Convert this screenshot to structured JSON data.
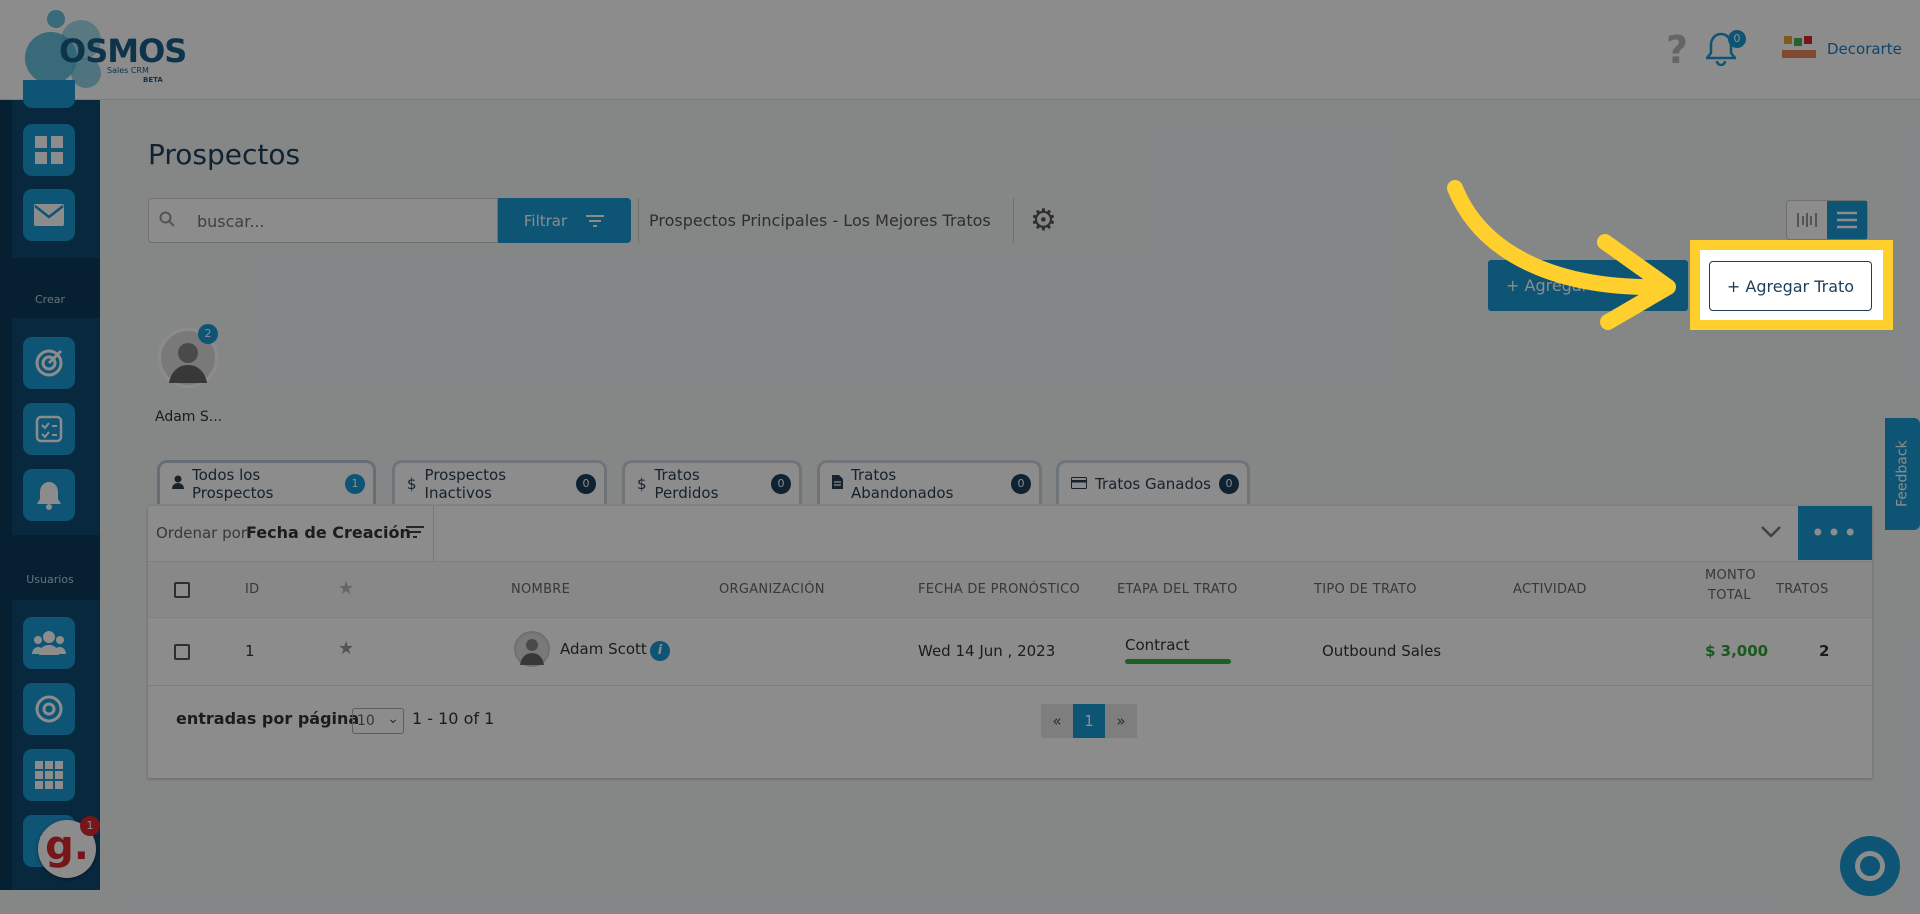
{
  "header": {
    "logo_word": "OSMOS",
    "logo_sub": "Sales CRM",
    "logo_beta": "BETA",
    "help_glyph": "?",
    "notifications_count": "0",
    "company_name": "Decorarte"
  },
  "sidebar": {
    "section_create": "Crear",
    "section_users": "Usuarios",
    "buttons": [
      {
        "icon": "dashboard-icon"
      },
      {
        "icon": "mail-icon"
      },
      {
        "icon": "target-icon"
      },
      {
        "icon": "tasks-icon"
      },
      {
        "icon": "alert-icon"
      },
      {
        "icon": "users-icon"
      },
      {
        "icon": "goal-icon"
      },
      {
        "icon": "grid-icon"
      }
    ],
    "g_badge_letter": "g.",
    "g_badge_count": "1"
  },
  "page": {
    "title": "Prospectos",
    "search_placeholder": "buscar...",
    "filter_label": "Filtrar",
    "pipeline_name": "Prospectos Principales - Los Mejores Tratos",
    "add_prospect_label": "+ Agregar Prospecto",
    "add_deal_label": "+ Agregar Trato"
  },
  "owner": {
    "name": "Adam S...",
    "badge": "2"
  },
  "tabs": [
    {
      "label": "Todos los Prospectos",
      "count": "1",
      "icon": "user-icon"
    },
    {
      "label": "Prospectos Inactivos",
      "count": "0",
      "icon": "dollar-icon"
    },
    {
      "label": "Tratos Perdidos",
      "count": "0",
      "icon": "dollar-icon"
    },
    {
      "label": "Tratos Abandonados",
      "count": "0",
      "icon": "file-icon"
    },
    {
      "label": "Tratos Ganados",
      "count": "0",
      "icon": "card-icon"
    }
  ],
  "sort": {
    "label": "Ordenar por:",
    "value": "Fecha de Creación"
  },
  "table": {
    "columns": [
      "ID",
      "NOMBRE",
      "ORGANIZACIÓN",
      "FECHA DE PRONÓSTICO",
      "ETAPA DEL TRATO",
      "TIPO DE TRATO",
      "ACTIVIDAD",
      "MONTO",
      "TOTAL",
      "TRATOS"
    ],
    "row": {
      "id": "1",
      "name": "Adam Scott",
      "organization": "",
      "forecast_date": "Wed 14 Jun , 2023",
      "stage": "Contract",
      "deal_type": "Outbound Sales",
      "activity": "",
      "total": "$ 3,000",
      "deals": "2"
    }
  },
  "pagination": {
    "entries_label": "entradas por página",
    "page_size": "10",
    "range": "1 - 10 of 1",
    "prev": "«",
    "current": "1",
    "next": "»"
  },
  "feedback_label": "Feedback",
  "colors": {
    "accent": "#1a9ad6",
    "sidebar": "#0b3b5c",
    "highlight": "#ffcf2e",
    "success": "#36b03e"
  }
}
